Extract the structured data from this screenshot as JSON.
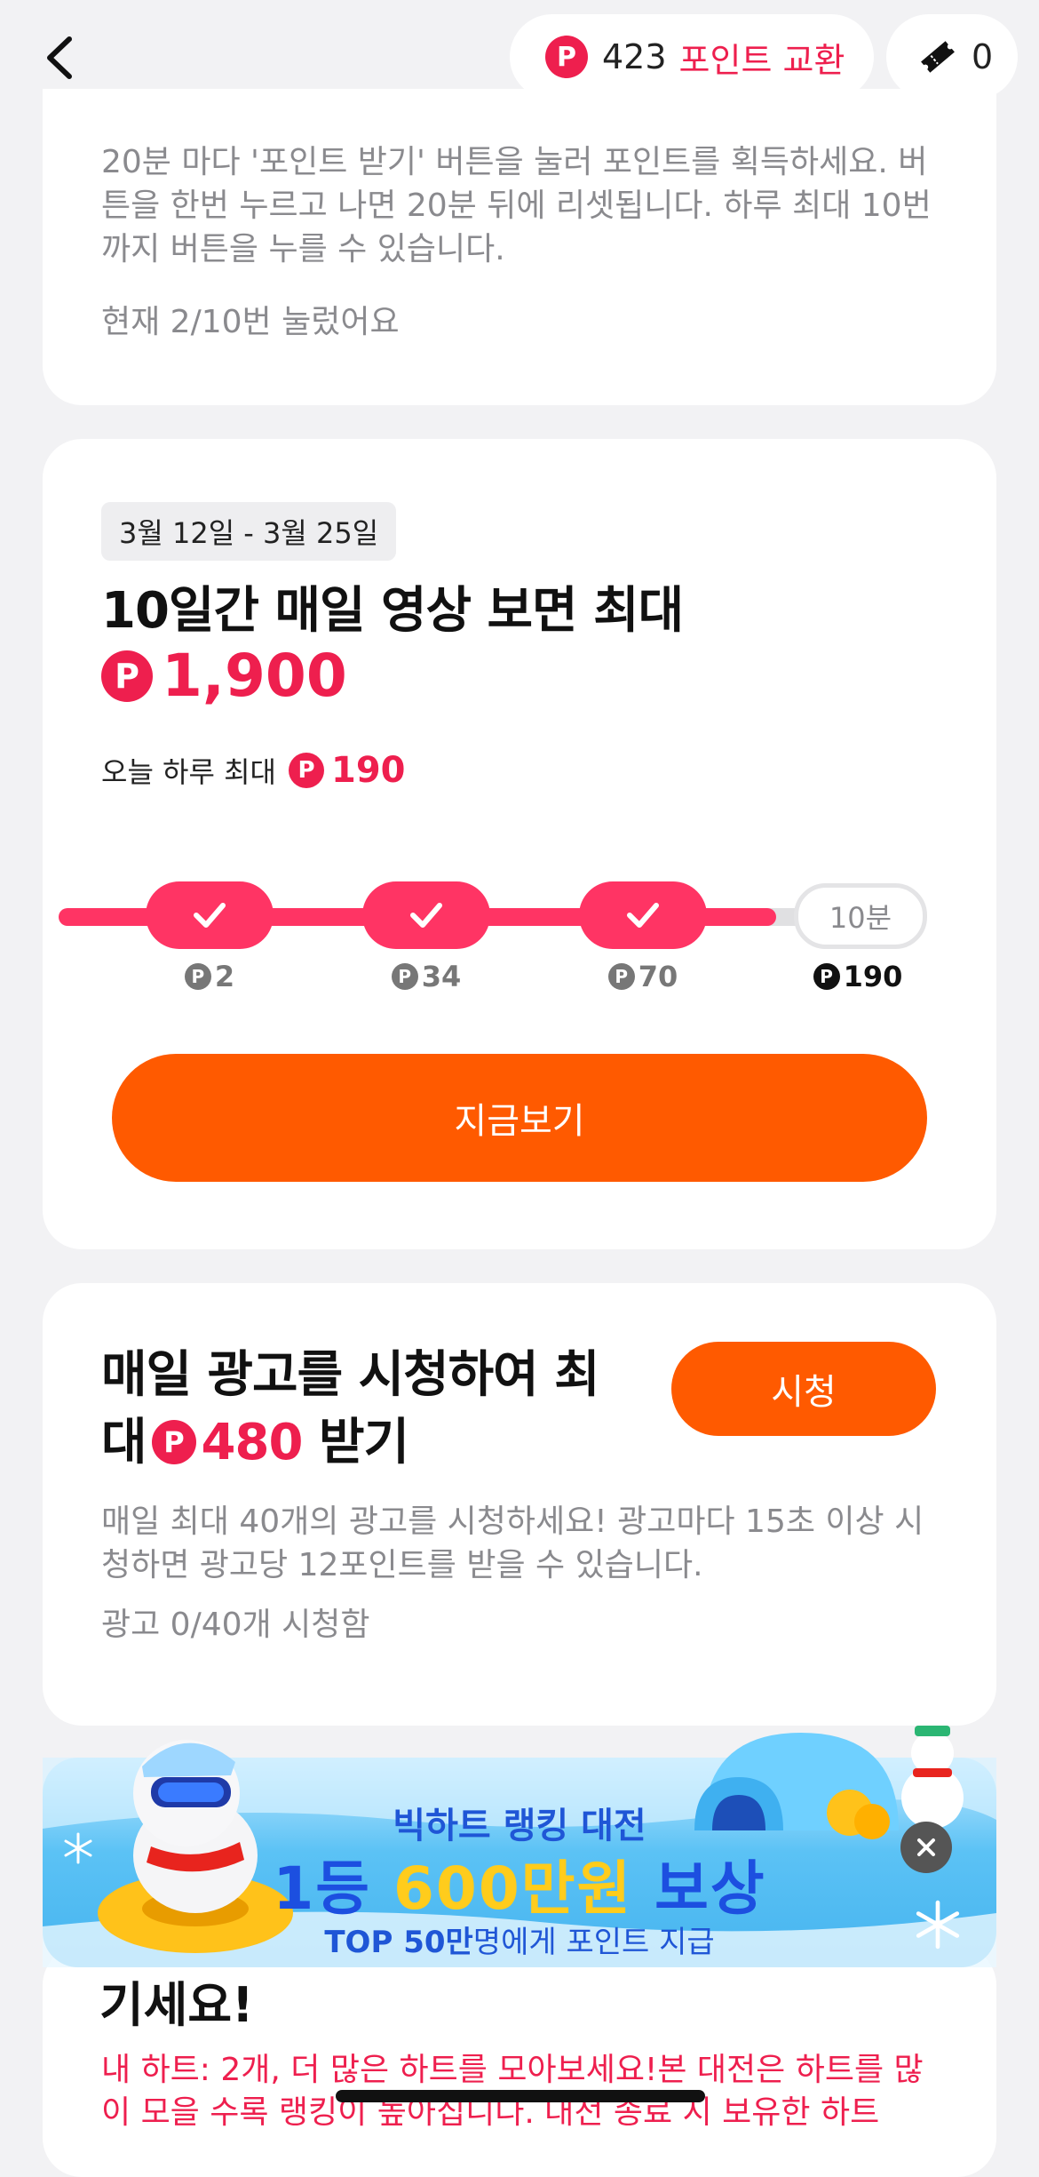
{
  "header": {
    "points": "423",
    "exchange_label": "포인트 교환",
    "tickets": "0",
    "coin_symbol": "P"
  },
  "card1": {
    "description": "20분 마다 '포인트 받기' 버튼을 눌러 포인트를 획득하세요. 버튼을 한번 누르고 나면 20분 뒤에 리셋됩니다. 하루 최대 10번까지 버튼을 누를 수 있습니다.",
    "progress_text": "현재 2/10번 눌렀어요",
    "presses_done": 2,
    "presses_max": 10
  },
  "card2": {
    "date_range": "3월 12일 - 3월 25일",
    "title": "10일간 매일 영상 보면 최대",
    "max_points": "1,900",
    "today_label": "오늘 하루 최대",
    "today_points": "190",
    "steps": [
      {
        "reward": "2",
        "done": true
      },
      {
        "reward": "34",
        "done": true
      },
      {
        "reward": "70",
        "done": true
      },
      {
        "reward": "190",
        "done": false,
        "label": "10분"
      }
    ],
    "cta_label": "지금보기"
  },
  "card3": {
    "title_prefix": "매일 광고를 시청하여 최대",
    "title_points": "480",
    "title_suffix": "받기",
    "watch_label": "시청",
    "description": "매일 최대 40개의 광고를 시청하세요! 광고마다 15초 이상 시청하면 광고당 12포인트를 받을 수 있습니다.",
    "progress_text": "광고 0/40개 시청함"
  },
  "banner": {
    "line1": "빅하트 랭킹 대전",
    "line2_a": "1등 ",
    "line2_b": "600만원",
    "line2_c": " 보상",
    "line3_a": "TOP 50만",
    "line3_b": "명에게 포인트 지급"
  },
  "card4": {
    "title_tail": "기세요!",
    "red_text": "내 하트: 2개, 더 많은 하트를 모아보세요!본 대전은 하트를 많이 모을 수록 랭킹이 높아집니다. 대전 종료 시 보유한 하트"
  },
  "colors": {
    "accent_red": "#ee1f4e",
    "cta_orange": "#ff5a00",
    "progress_pink": "#ff3464"
  }
}
